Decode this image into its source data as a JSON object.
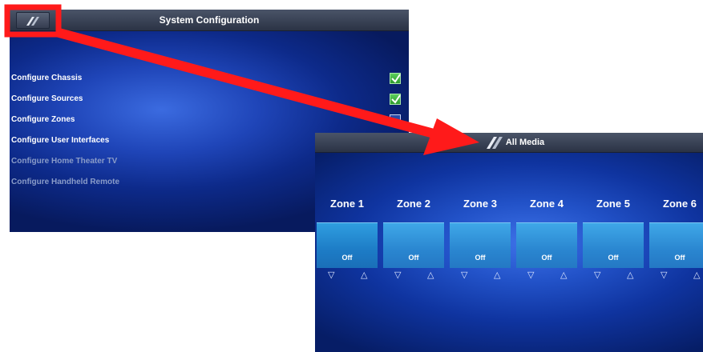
{
  "system_config": {
    "title": "System Configuration",
    "home_icon": "crestron-logo-icon",
    "items": [
      {
        "label": "Configure Chassis",
        "enabled": true,
        "checked": true
      },
      {
        "label": "Configure Sources",
        "enabled": true,
        "checked": true
      },
      {
        "label": "Configure Zones",
        "enabled": true,
        "checked": false
      },
      {
        "label": "Configure User Interfaces",
        "enabled": true,
        "checked": false
      },
      {
        "label": "Configure Home Theater TV",
        "enabled": false,
        "checked": false
      },
      {
        "label": "Configure Handheld Remote",
        "enabled": false,
        "checked": false
      }
    ]
  },
  "all_media": {
    "title": "All Media",
    "title_icon": "crestron-logo-icon",
    "zones": [
      {
        "name": "Zone 1",
        "status": "Off",
        "vol_down": "▽",
        "vol_up": "△"
      },
      {
        "name": "Zone 2",
        "status": "Off",
        "vol_down": "▽",
        "vol_up": "△"
      },
      {
        "name": "Zone 3",
        "status": "Off",
        "vol_down": "▽",
        "vol_up": "△"
      },
      {
        "name": "Zone 4",
        "status": "Off",
        "vol_down": "▽",
        "vol_up": "△"
      },
      {
        "name": "Zone 5",
        "status": "Off",
        "vol_down": "▽",
        "vol_up": "△"
      },
      {
        "name": "Zone 6",
        "status": "Off",
        "vol_down": "▽",
        "vol_up": "△"
      }
    ]
  },
  "annotation": {
    "color": "#ff1a1a",
    "shapes": [
      "highlight-box-icon",
      "arrow-icon"
    ]
  }
}
